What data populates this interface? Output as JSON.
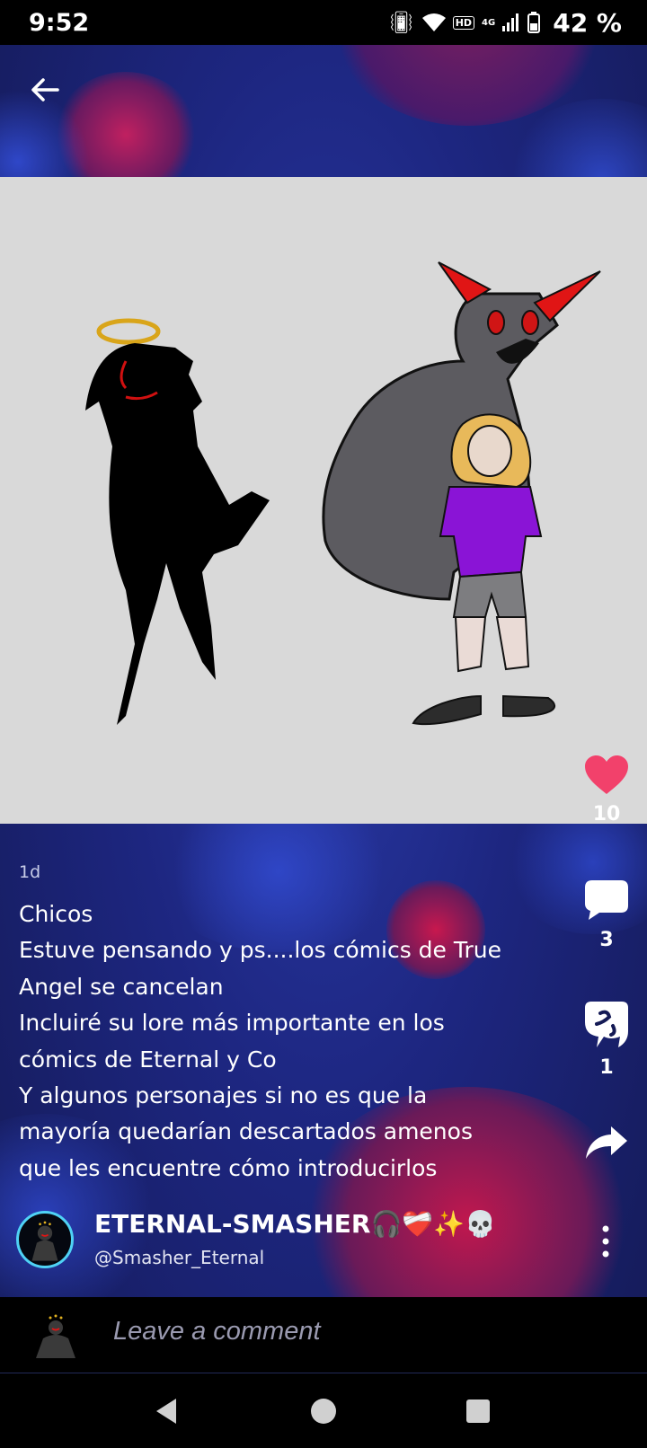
{
  "status_bar": {
    "time": "9:52",
    "hd_label": "HD",
    "network_label": "4G",
    "battery_percent": "42 %"
  },
  "header": {
    "back_icon": "arrow-left-icon"
  },
  "post": {
    "time_ago": "1d",
    "lines": [
      "Chicos",
      "Estuve pensando y ps....los cómics de True",
      "Angel se cancelan",
      "Incluiré su lore más importante en los",
      "cómics de Eternal y Co",
      "Y algunos personajes si no es que la",
      "mayoría quedarían descartados amenos",
      "que les encuentre cómo introducirlos"
    ]
  },
  "actions": {
    "like_icon": "heart-icon",
    "like_count": "10",
    "comment_icon": "comment-bubble-icon",
    "comment_count": "3",
    "props_icon": "props-icon",
    "props_count": "1",
    "share_icon": "share-arrow-icon"
  },
  "author": {
    "name": "ETERNAL-SMASHER🎧❤️‍🩹✨💀",
    "handle": "@Smasher_Eternal"
  },
  "comment_bar": {
    "placeholder": "Leave a comment"
  },
  "colors": {
    "like": "#f2416b",
    "avatar_ring": "#4fd2f5",
    "background": "#1d2680"
  }
}
